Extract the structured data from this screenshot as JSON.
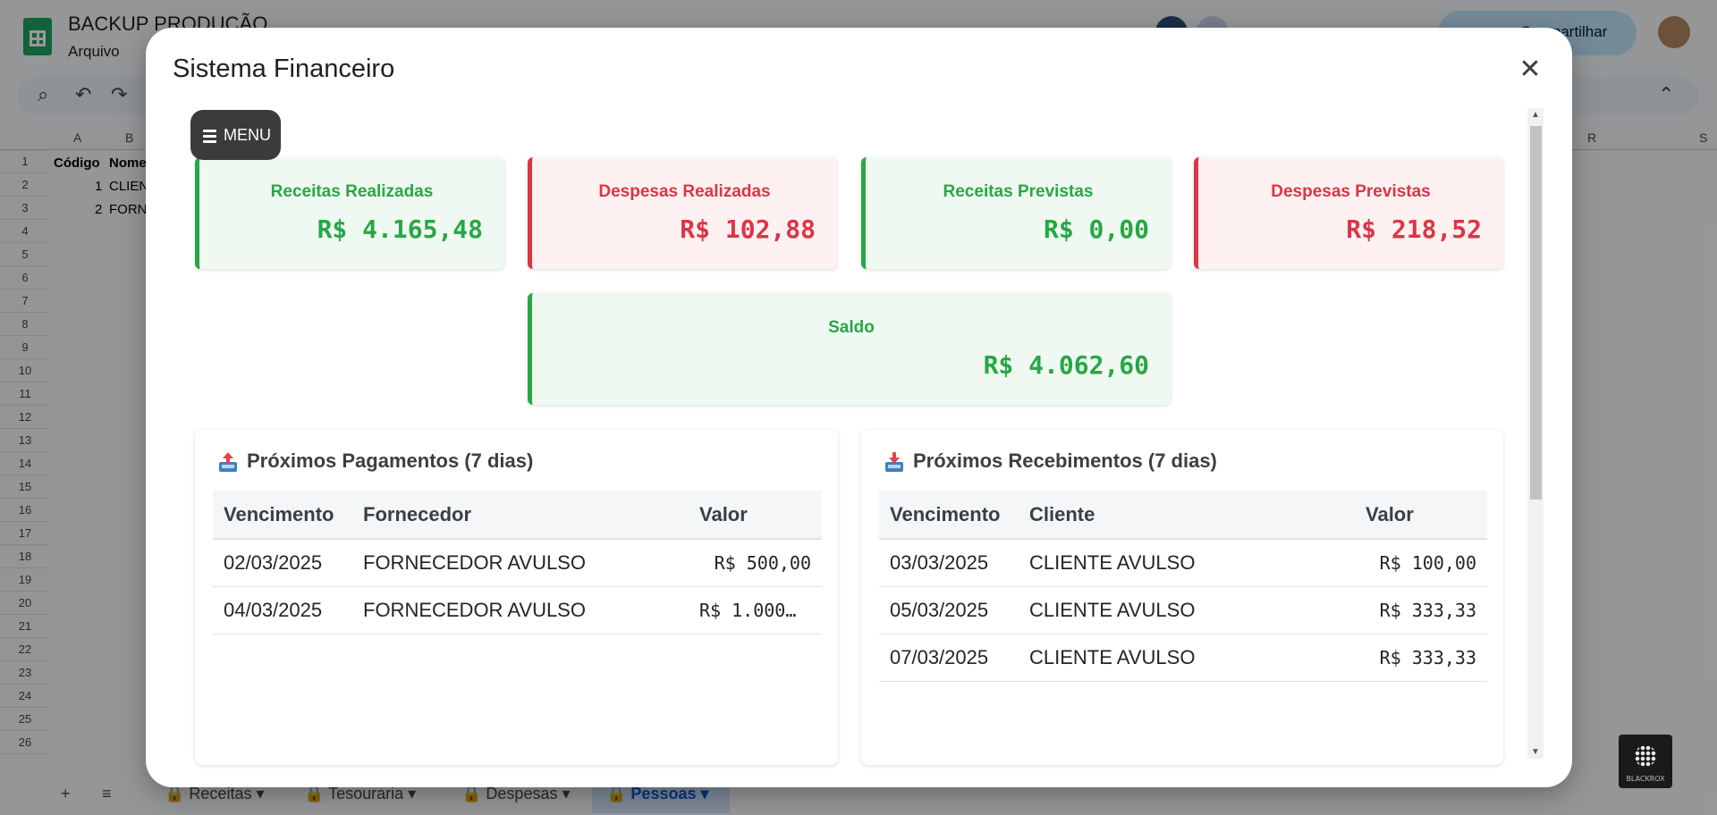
{
  "background": {
    "doc_title": "BACKUP PRODUÇÃO",
    "menu_first": "Arquivo",
    "share_label": "Compartilhar",
    "columns": [
      "A",
      "B",
      "R",
      "S"
    ],
    "rows": [
      "1",
      "2",
      "3",
      "4",
      "5",
      "6",
      "7",
      "8",
      "9",
      "10",
      "11",
      "12",
      "13",
      "14",
      "15",
      "16",
      "17",
      "18",
      "19",
      "20",
      "21",
      "22",
      "23",
      "24",
      "25",
      "26"
    ],
    "cells": {
      "a1": "Código",
      "b1": "Nome",
      "a2": "1",
      "b2": "CLIEN",
      "a3": "2",
      "b3": "FORN"
    },
    "sheet_tabs": [
      "Receitas",
      "Tesouraria",
      "Despesas",
      "Pessoas"
    ],
    "active_tab": "Pessoas"
  },
  "modal": {
    "title": "Sistema Financeiro",
    "close_label": "✕",
    "menu_label": "MENU"
  },
  "cards": {
    "receitas_realizadas": {
      "title": "Receitas Realizadas",
      "value": "R$ 4.165,48"
    },
    "despesas_realizadas": {
      "title": "Despesas Realizadas",
      "value": "R$ 102,88"
    },
    "receitas_previstas": {
      "title": "Receitas Previstas",
      "value": "R$ 0,00"
    },
    "despesas_previstas": {
      "title": "Despesas Previstas",
      "value": "R$ 218,52"
    },
    "saldo": {
      "title": "Saldo",
      "value": "R$ 4.062,60"
    }
  },
  "pagamentos": {
    "title": "Próximos Pagamentos (7 dias)",
    "headers": [
      "Vencimento",
      "Fornecedor",
      "Valor"
    ],
    "rows": [
      [
        "02/03/2025",
        "FORNECEDOR AVULSO",
        "R$ 500,00"
      ],
      [
        "04/03/2025",
        "FORNECEDOR AVULSO",
        "R$ 1.000…"
      ]
    ]
  },
  "recebimentos": {
    "title": "Próximos Recebimentos (7 dias)",
    "headers": [
      "Vencimento",
      "Cliente",
      "Valor"
    ],
    "rows": [
      [
        "03/03/2025",
        "CLIENTE AVULSO",
        "R$ 100,00"
      ],
      [
        "05/03/2025",
        "CLIENTE AVULSO",
        "R$ 333,33"
      ],
      [
        "07/03/2025",
        "CLIENTE AVULSO",
        "R$ 333,33"
      ]
    ]
  },
  "colors": {
    "green": "#28a745",
    "red": "#dc3545",
    "green_bg": "#eff8f1",
    "red_bg": "#fdf1f2"
  },
  "badge": {
    "label": "BLACKROX"
  }
}
